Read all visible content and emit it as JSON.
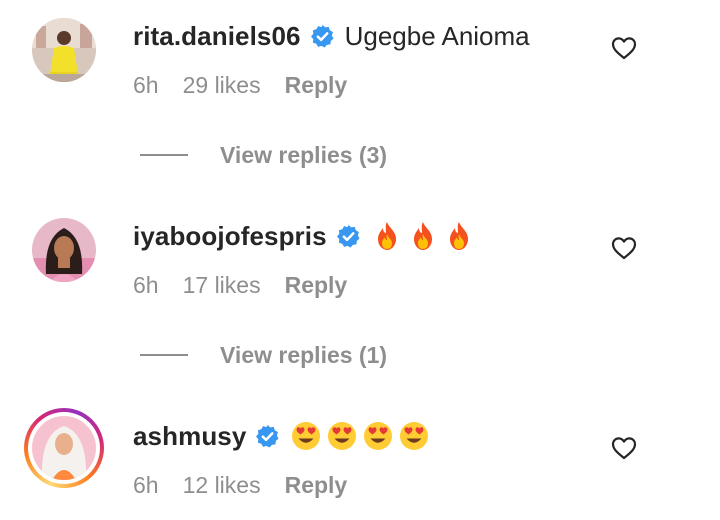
{
  "comments": [
    {
      "username": "rita.daniels06",
      "text": "Ugegbe Anioma",
      "emojis": [],
      "time": "6h",
      "likes": "29 likes",
      "reply": "Reply",
      "view_replies": "View replies (3)"
    },
    {
      "username": "iyaboojofespris",
      "text": "",
      "emojis": [
        "fire-emoji",
        "fire-emoji",
        "fire-emoji"
      ],
      "time": "6h",
      "likes": "17 likes",
      "reply": "Reply",
      "view_replies": "View replies (1)"
    },
    {
      "username": "ashmusy",
      "text": "",
      "emojis": [
        "heart-eyes-emoji",
        "heart-eyes-emoji",
        "heart-eyes-emoji",
        "heart-eyes-emoji"
      ],
      "time": "6h",
      "likes": "12 likes",
      "reply": "Reply"
    }
  ],
  "colors": {
    "text": "#262626",
    "muted": "#8e8e8e",
    "verified_blue": "#3897f0",
    "story_ring": [
      "#feda75",
      "#fa7e1e",
      "#d62976",
      "#962fbf"
    ]
  }
}
